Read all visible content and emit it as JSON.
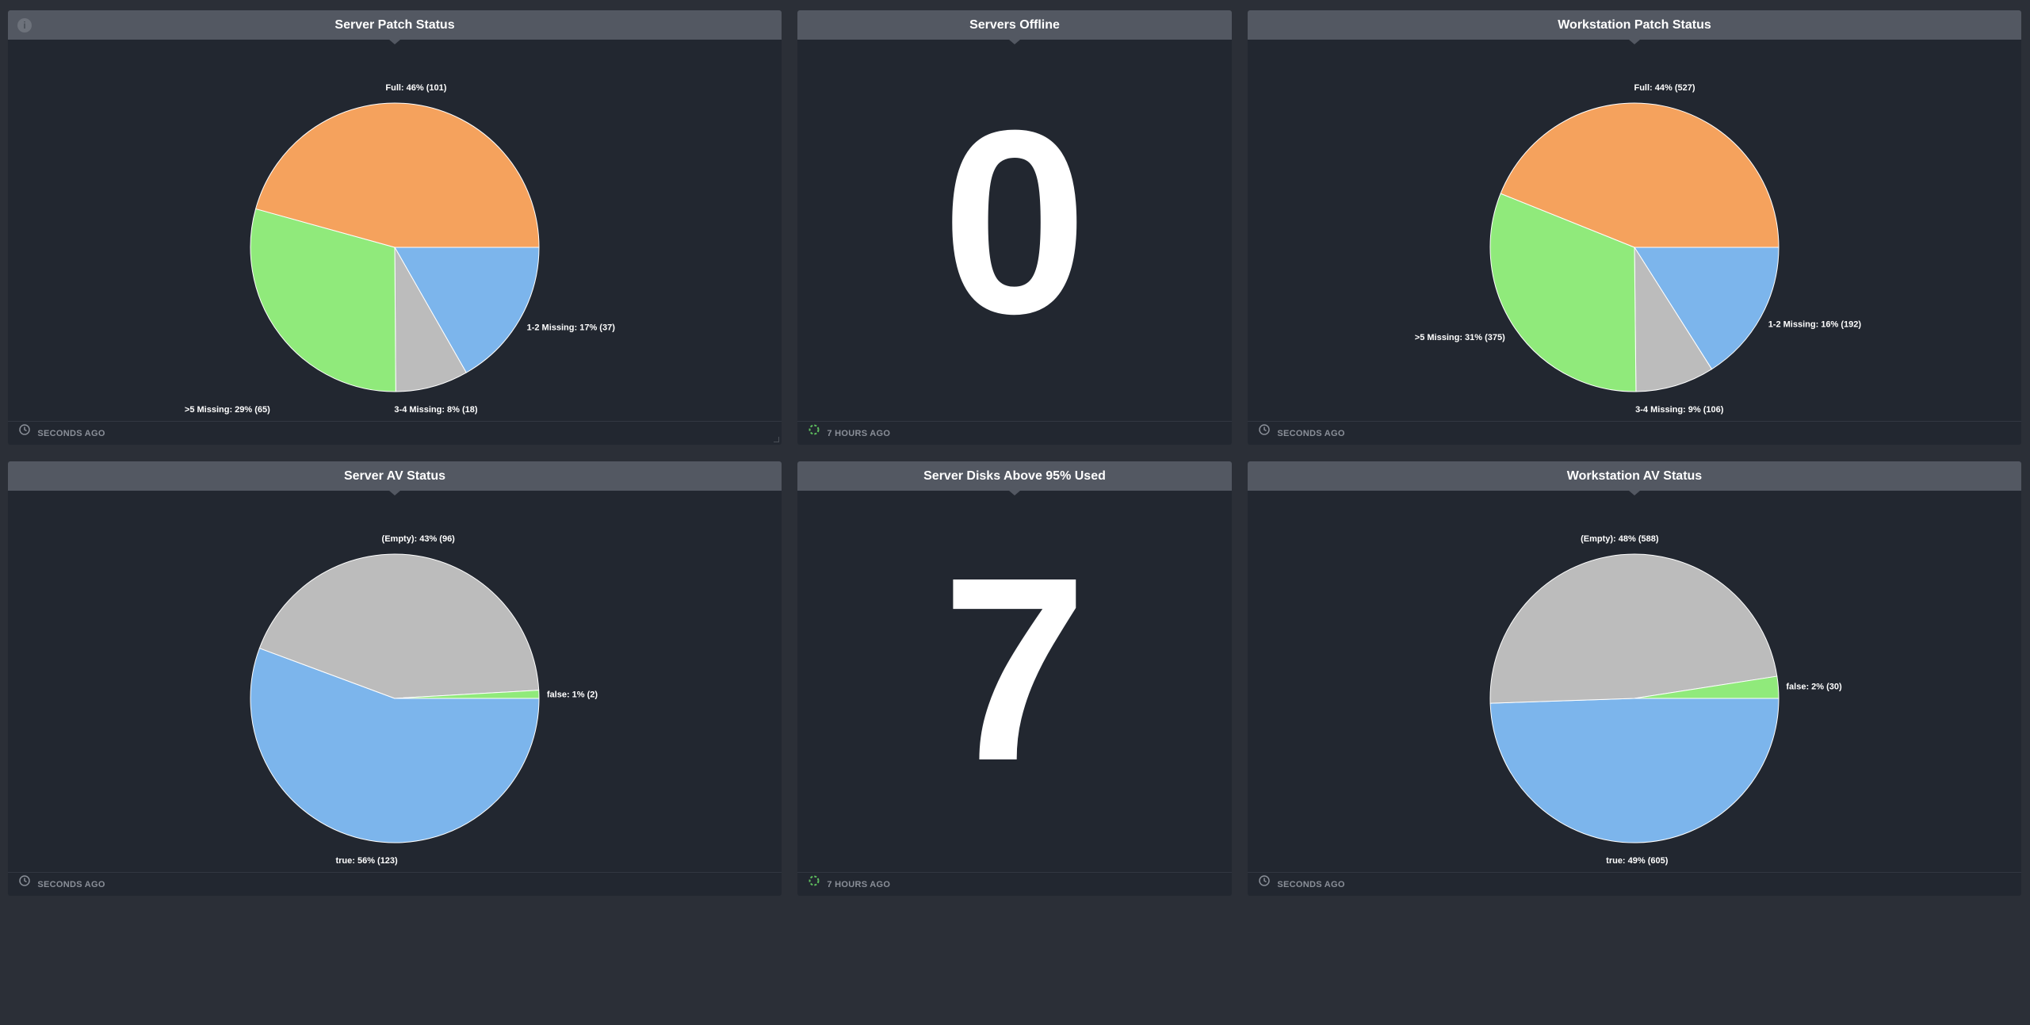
{
  "colors": {
    "orange": "#f5a25d",
    "green": "#90ea7b",
    "blue": "#7cb5ec",
    "gray": "#bcbcbc",
    "stroke": "#ffffff"
  },
  "panels": {
    "server_patch": {
      "title": "Server Patch Status",
      "footer_icon": "clock-icon",
      "footer": "SECONDS AGO"
    },
    "servers_offline": {
      "title": "Servers Offline",
      "value": "0",
      "footer_icon": "refresh-spinner-icon",
      "footer": "7 HOURS AGO"
    },
    "workstation_patch": {
      "title": "Workstation Patch Status",
      "footer_icon": "clock-icon",
      "footer": "SECONDS AGO"
    },
    "server_av": {
      "title": "Server AV Status",
      "footer_icon": "clock-icon",
      "footer": "SECONDS AGO"
    },
    "server_disks": {
      "title": "Server Disks Above 95% Used",
      "value": "7",
      "footer_icon": "refresh-spinner-icon",
      "footer": "7 HOURS AGO"
    },
    "workstation_av": {
      "title": "Workstation AV Status",
      "footer_icon": "clock-icon",
      "footer": "SECONDS AGO"
    }
  },
  "chart_data": [
    {
      "id": "server_patch",
      "type": "pie",
      "title": "Server Patch Status",
      "slices": [
        {
          "name": "1-2 Missing",
          "value": 37,
          "percent": 17,
          "label": "1-2 Missing: 17% (37)",
          "color": "#7cb5ec"
        },
        {
          "name": "3-4 Missing",
          "value": 18,
          "percent": 8,
          "label": "3-4 Missing: 8% (18)",
          "color": "#bcbcbc"
        },
        {
          "name": ">5 Missing",
          "value": 65,
          "percent": 29,
          "label": ">5 Missing: 29% (65)",
          "color": "#90ea7b"
        },
        {
          "name": "Full",
          "value": 101,
          "percent": 46,
          "label": "Full: 46% (101)",
          "color": "#f5a25d"
        }
      ]
    },
    {
      "id": "workstation_patch",
      "type": "pie",
      "title": "Workstation Patch Status",
      "slices": [
        {
          "name": "1-2 Missing",
          "value": 192,
          "percent": 16,
          "label": "1-2 Missing: 16% (192)",
          "color": "#7cb5ec"
        },
        {
          "name": "3-4 Missing",
          "value": 106,
          "percent": 9,
          "label": "3-4 Missing: 9% (106)",
          "color": "#bcbcbc"
        },
        {
          "name": ">5 Missing",
          "value": 375,
          "percent": 31,
          "label": ">5 Missing: 31% (375)",
          "color": "#90ea7b"
        },
        {
          "name": "Full",
          "value": 527,
          "percent": 44,
          "label": "Full: 44% (527)",
          "color": "#f5a25d"
        }
      ]
    },
    {
      "id": "server_av",
      "type": "pie",
      "title": "Server AV Status",
      "slices": [
        {
          "name": "true",
          "value": 123,
          "percent": 56,
          "label": "true: 56% (123)",
          "color": "#7cb5ec"
        },
        {
          "name": "(Empty)",
          "value": 96,
          "percent": 43,
          "label": "(Empty): 43% (96)",
          "color": "#bcbcbc"
        },
        {
          "name": "false",
          "value": 2,
          "percent": 1,
          "label": "false: 1% (2)",
          "color": "#90ea7b"
        }
      ]
    },
    {
      "id": "workstation_av",
      "type": "pie",
      "title": "Workstation AV Status",
      "slices": [
        {
          "name": "true",
          "value": 605,
          "percent": 49,
          "label": "true: 49% (605)",
          "color": "#7cb5ec"
        },
        {
          "name": "(Empty)",
          "value": 588,
          "percent": 48,
          "label": "(Empty): 48% (588)",
          "color": "#bcbcbc"
        },
        {
          "name": "false",
          "value": 30,
          "percent": 2,
          "label": "false: 2% (30)",
          "color": "#90ea7b"
        }
      ]
    }
  ]
}
